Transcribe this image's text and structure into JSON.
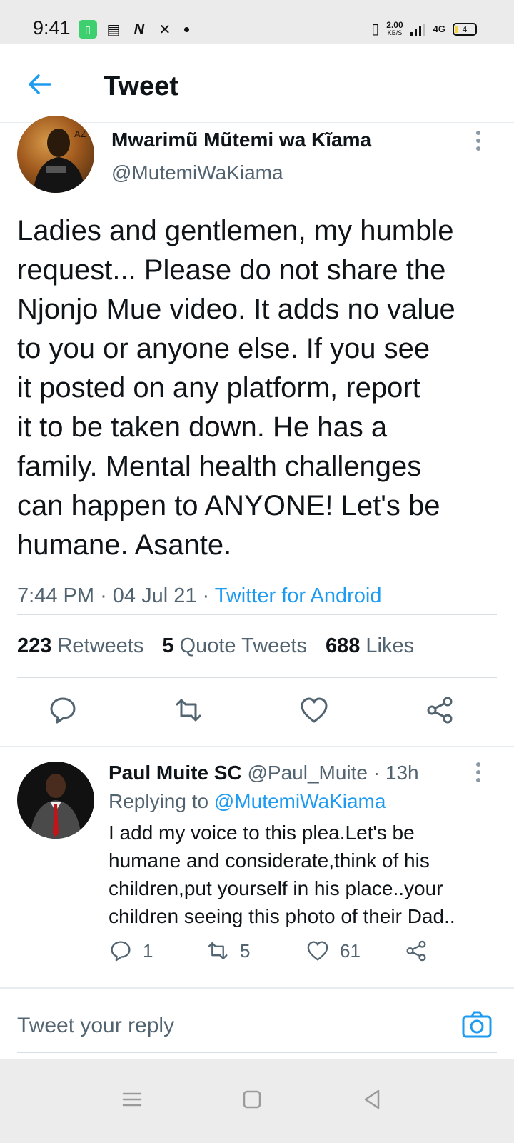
{
  "status_bar": {
    "time": "9:41",
    "speed_value": "2.00",
    "speed_unit": "KB/S",
    "network": "4G",
    "battery": "4"
  },
  "header": {
    "title": "Tweet",
    "back_icon": "arrow-left-icon"
  },
  "tweet": {
    "author_name": "Mwarimũ Mũtemi wa Kĩama",
    "author_handle": "@MutemiWaKiama",
    "text": "Ladies and gentlemen, my humble\nrequest... Please do not share the\nNjonjo Mue video. It adds no value\nto you or anyone else. If you see\nit posted on any platform, report\nit to be taken down. He has a\nfamily. Mental health challenges\ncan happen to ANYONE!  Let's be\nhumane. Asante.",
    "time": "7:44 PM",
    "date": "04 Jul 21",
    "source": "Twitter for Android",
    "retweets_count": "223",
    "retweets_label": "Retweets",
    "quotes_count": "5",
    "quotes_label": "Quote Tweets",
    "likes_count": "688",
    "likes_label": "Likes"
  },
  "reply": {
    "author_name": "Paul Muite SC",
    "author_handle": "@Paul_Muite",
    "age": "13h",
    "replying_prefix": "Replying to",
    "replying_to": "@MutemiWaKiama",
    "text": "I add my voice to this plea.Let's be\nhumane and considerate,think of his\nchildren,put yourself in his place..your\nchildren seeing this photo of their Dad..",
    "reply_count": "1",
    "retweet_count": "5",
    "like_count": "61"
  },
  "compose": {
    "placeholder": "Tweet your reply"
  },
  "colors": {
    "accent": "#1d9bf0",
    "secondary_text": "#536471",
    "primary_text": "#0f1419"
  }
}
